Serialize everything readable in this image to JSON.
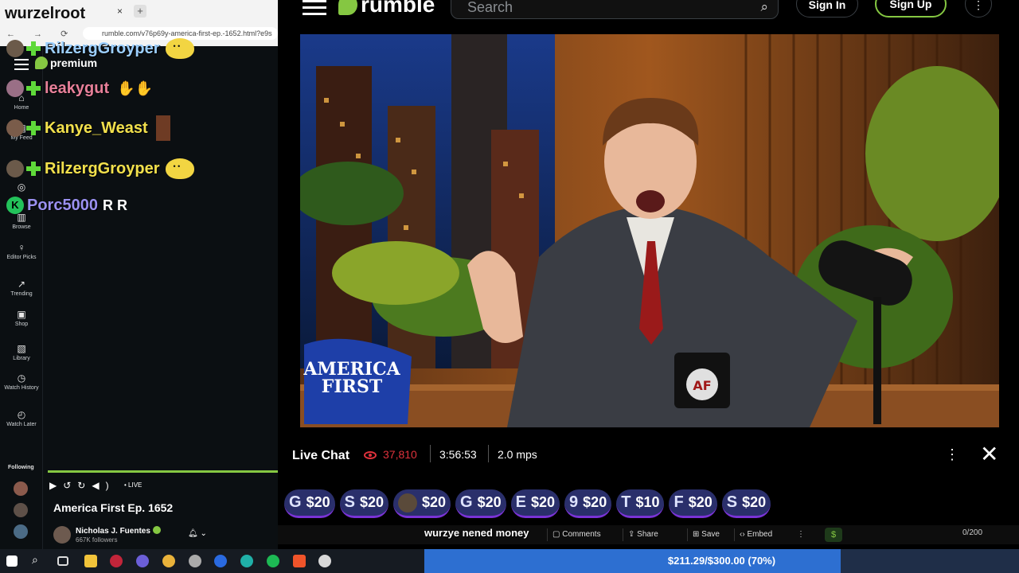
{
  "browser": {
    "tab_title": "wurzelroot",
    "tab_close": "×",
    "tab_new": "+",
    "nav": "← → ⟳ ⌂",
    "url": "rumble.com/v76p69y-america-first-ep.-1652.html?e9s"
  },
  "sidebar": {
    "premium_label": "premium",
    "items": [
      {
        "label": "Home",
        "icon": "⌂"
      },
      {
        "label": "My Feed",
        "icon": "▤"
      },
      {
        "label": "",
        "icon": "◎"
      },
      {
        "label": "Browse",
        "icon": "▥"
      },
      {
        "label": "Editor Picks",
        "icon": "♀"
      },
      {
        "label": "Trending",
        "icon": "↗"
      },
      {
        "label": "Shop",
        "icon": "▣"
      },
      {
        "label": "Library",
        "icon": "▧"
      },
      {
        "label": "Watch History",
        "icon": "◷"
      },
      {
        "label": "Watch Later",
        "icon": "◴"
      }
    ],
    "following_label": "Following"
  },
  "overlay_chat": [
    {
      "user": "RilzergGroyper",
      "color": "#9ccfff",
      "message": ""
    },
    {
      "user": "leakygut",
      "color": "#e8809a",
      "message": ""
    },
    {
      "user": "Kanye_Weast",
      "color": "#f2e04c",
      "message": ""
    },
    {
      "user": "RilzergGroyper",
      "color": "#f2e04c",
      "message": ""
    },
    {
      "user": "Porc5000",
      "color": "#9a90f0",
      "message": "R R"
    }
  ],
  "mini_player": {
    "live_label": "• LIVE",
    "title": "America First Ep. 1652",
    "channel": "Nicholas J. Fuentes",
    "followers": "667K followers"
  },
  "header": {
    "logo_text": "rumble",
    "search_placeholder": "Search",
    "sign_in": "Sign In",
    "sign_up": "Sign Up",
    "more": "⋮"
  },
  "video_scene": {
    "hat_line1": "AMERICA",
    "hat_line2": "FIRST",
    "mug_text": "AF"
  },
  "live_chat": {
    "title": "Live Chat",
    "viewers": "37,810",
    "duration": "3:56:53",
    "mps": "2.0 mps",
    "more": "⋮",
    "close": "✕"
  },
  "rants": [
    {
      "letter": "G",
      "amount": "$20"
    },
    {
      "letter": "S",
      "amount": "$20"
    },
    {
      "letter": "",
      "amount": "$20"
    },
    {
      "letter": "G",
      "amount": "$20"
    },
    {
      "letter": "E",
      "amount": "$20"
    },
    {
      "letter": "9",
      "amount": "$20"
    },
    {
      "letter": "T",
      "amount": "$10"
    },
    {
      "letter": "F",
      "amount": "$20"
    },
    {
      "letter": "S",
      "amount": "$20"
    }
  ],
  "actions": {
    "overlay_text": "wurzye nened money",
    "comments": "Comments",
    "share": "Share",
    "save": "Save",
    "embed": "Embed",
    "dollar": "$",
    "char_count": "0/200"
  },
  "goal": {
    "text": "$211.29/$300.00 (70%)",
    "progress": 0.7
  }
}
